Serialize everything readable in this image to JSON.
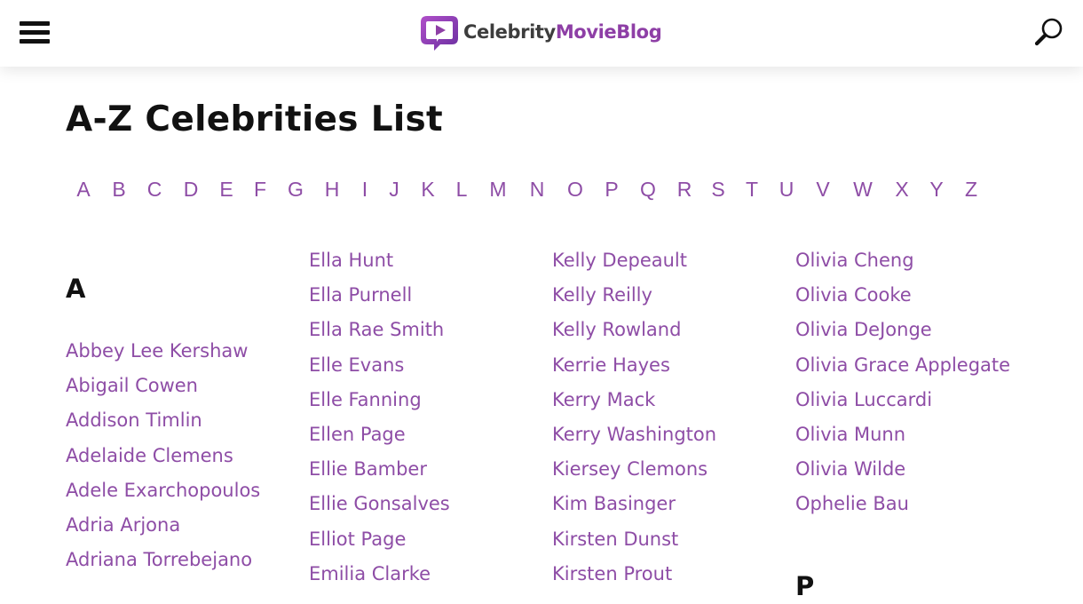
{
  "header": {
    "logo_part1": "Celebrity",
    "logo_part2": "MovieBlog"
  },
  "page": {
    "title": "A-Z Celebrities List"
  },
  "alphabet": [
    "A",
    "B",
    "C",
    "D",
    "E",
    "F",
    "G",
    "H",
    "I",
    "J",
    "K",
    "L",
    "M",
    "N",
    "O",
    "P",
    "Q",
    "R",
    "S",
    "T",
    "U",
    "V",
    "W",
    "X",
    "Y",
    "Z"
  ],
  "sections": {
    "a_heading": "A",
    "p_heading": "P"
  },
  "columns": [
    [
      "Abbey Lee Kershaw",
      "Abigail Cowen",
      "Addison Timlin",
      "Adelaide Clemens",
      "Adele Exarchopoulos",
      "Adria Arjona",
      "Adriana Torrebejano"
    ],
    [
      "Ella Hunt",
      "Ella Purnell",
      "Ella Rae Smith",
      "Elle Evans",
      "Elle Fanning",
      "Ellen Page",
      "Ellie Bamber",
      "Ellie Gonsalves",
      "Elliot Page",
      "Emilia Clarke"
    ],
    [
      "Kelly Depeault",
      "Kelly Reilly",
      "Kelly Rowland",
      "Kerrie Hayes",
      "Kerry Mack",
      "Kerry Washington",
      "Kiersey Clemons",
      "Kim Basinger",
      "Kirsten Dunst",
      "Kirsten Prout"
    ],
    [
      "Olivia Cheng",
      "Olivia Cooke",
      "Olivia DeJonge",
      "Olivia Grace Applegate",
      "Olivia Luccardi",
      "Olivia Munn",
      "Olivia Wilde",
      "Ophelie Bau"
    ]
  ],
  "colors": {
    "link": "#8e4da6",
    "brand_purple": "#8e3fa6",
    "text_dark": "#111111"
  }
}
